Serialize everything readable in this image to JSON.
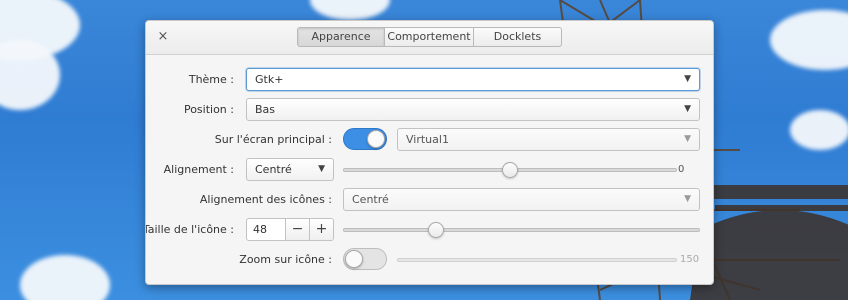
{
  "window": {
    "close_glyph": "×",
    "tabs": [
      {
        "label": "Apparence",
        "active": true
      },
      {
        "label": "Comportement",
        "active": false
      },
      {
        "label": "Docklets",
        "active": false
      }
    ]
  },
  "settings": {
    "theme": {
      "label": "Thème :",
      "value": "Gtk+"
    },
    "position": {
      "label": "Position :",
      "value": "Bas"
    },
    "primary_screen": {
      "label": "Sur l'écran principal :",
      "toggle_on": true,
      "monitor": "Virtual1"
    },
    "alignment": {
      "label": "Alignement :",
      "value": "Centré",
      "offset_value": "0",
      "offset_fraction": 0.5
    },
    "icon_alignment": {
      "label": "Alignement des icônes :",
      "value": "Centré"
    },
    "icon_size": {
      "label": "Taille de l'icône :",
      "value": "48",
      "minus": "−",
      "plus": "+",
      "slider_fraction": 0.25
    },
    "zoom": {
      "label": "Zoom sur icône :",
      "toggle_on": false,
      "value": "150",
      "slider_fraction": 1.0
    }
  },
  "icons": {
    "dropdown": "chevron-down-icon",
    "close": "close-icon"
  },
  "colors": {
    "accent": "#3d8fe6",
    "focus_border": "#5a9ad5"
  }
}
